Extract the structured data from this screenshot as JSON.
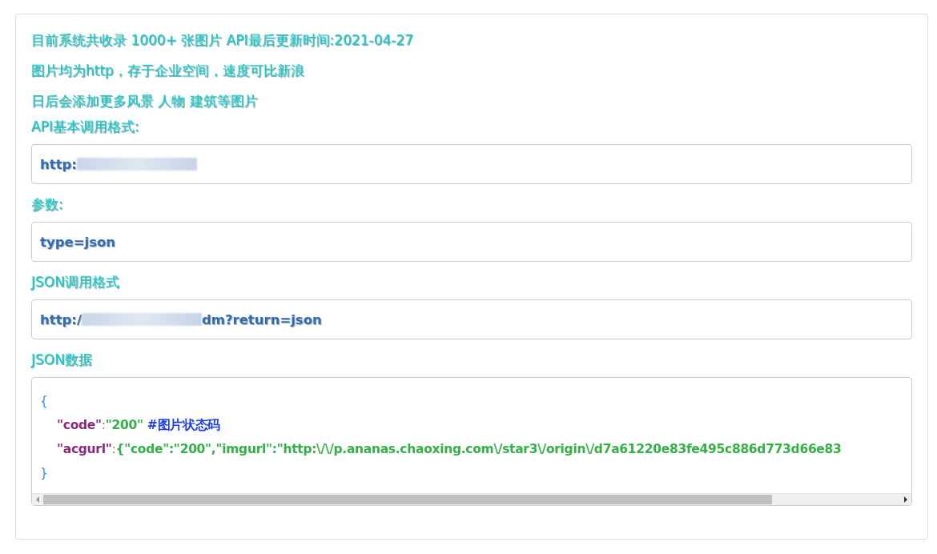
{
  "intro_lines": [
    "目前系统共收录 1000+ 张图片 API最后更新时间:2021-04-27",
    "图片均为http，存于企业空间，速度可比新浪",
    "日后会添加更多风景 人物 建筑等图片"
  ],
  "sections": [
    {
      "heading": "API基本调用格式:",
      "field": {
        "value_start": "http:",
        "redacted": true
      }
    },
    {
      "heading": "参数:",
      "field": {
        "value_start": "type=json",
        "redacted": false
      }
    },
    {
      "heading": "JSON调用格式",
      "field": {
        "value_start": "http:/",
        "redacted": true,
        "value_end": "dm?return=json"
      }
    }
  ],
  "json_block": {
    "heading": "JSON数据",
    "open_brace": "{",
    "close_brace": "}",
    "lines": [
      {
        "key": "\"code\"",
        "colon": ":",
        "value": "\"200\"",
        "comment": "#图片状态码"
      },
      {
        "key": "\"acgurl\"",
        "colon": ":",
        "value": "{\"code\":\"200\",\"imgurl\":\"http:\\/\\/p.ananas.chaoxing.com\\/star3\\/origin\\/d7a61220e83fe495c886d773d66e83"
      }
    ]
  }
}
